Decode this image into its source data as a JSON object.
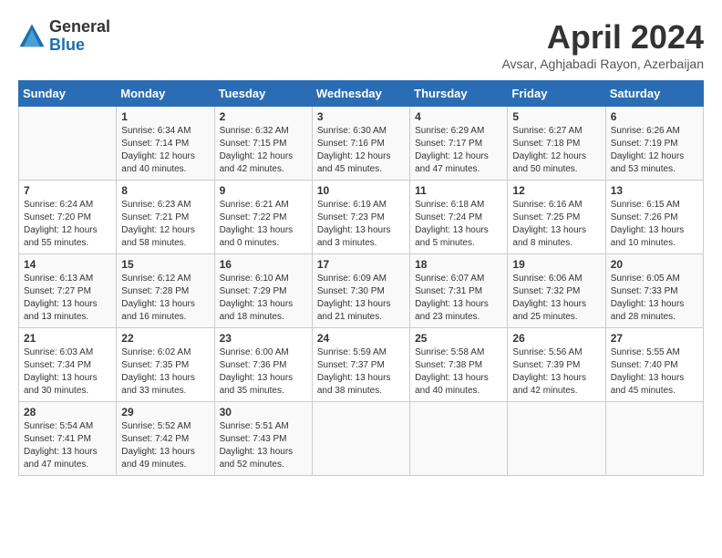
{
  "header": {
    "logo_general": "General",
    "logo_blue": "Blue",
    "title": "April 2024",
    "location": "Avsar, Aghjabadi Rayon, Azerbaijan"
  },
  "calendar": {
    "days_of_week": [
      "Sunday",
      "Monday",
      "Tuesday",
      "Wednesday",
      "Thursday",
      "Friday",
      "Saturday"
    ],
    "weeks": [
      [
        {
          "day": "",
          "sunrise": "",
          "sunset": "",
          "daylight": ""
        },
        {
          "day": "1",
          "sunrise": "Sunrise: 6:34 AM",
          "sunset": "Sunset: 7:14 PM",
          "daylight": "Daylight: 12 hours and 40 minutes."
        },
        {
          "day": "2",
          "sunrise": "Sunrise: 6:32 AM",
          "sunset": "Sunset: 7:15 PM",
          "daylight": "Daylight: 12 hours and 42 minutes."
        },
        {
          "day": "3",
          "sunrise": "Sunrise: 6:30 AM",
          "sunset": "Sunset: 7:16 PM",
          "daylight": "Daylight: 12 hours and 45 minutes."
        },
        {
          "day": "4",
          "sunrise": "Sunrise: 6:29 AM",
          "sunset": "Sunset: 7:17 PM",
          "daylight": "Daylight: 12 hours and 47 minutes."
        },
        {
          "day": "5",
          "sunrise": "Sunrise: 6:27 AM",
          "sunset": "Sunset: 7:18 PM",
          "daylight": "Daylight: 12 hours and 50 minutes."
        },
        {
          "day": "6",
          "sunrise": "Sunrise: 6:26 AM",
          "sunset": "Sunset: 7:19 PM",
          "daylight": "Daylight: 12 hours and 53 minutes."
        }
      ],
      [
        {
          "day": "7",
          "sunrise": "Sunrise: 6:24 AM",
          "sunset": "Sunset: 7:20 PM",
          "daylight": "Daylight: 12 hours and 55 minutes."
        },
        {
          "day": "8",
          "sunrise": "Sunrise: 6:23 AM",
          "sunset": "Sunset: 7:21 PM",
          "daylight": "Daylight: 12 hours and 58 minutes."
        },
        {
          "day": "9",
          "sunrise": "Sunrise: 6:21 AM",
          "sunset": "Sunset: 7:22 PM",
          "daylight": "Daylight: 13 hours and 0 minutes."
        },
        {
          "day": "10",
          "sunrise": "Sunrise: 6:19 AM",
          "sunset": "Sunset: 7:23 PM",
          "daylight": "Daylight: 13 hours and 3 minutes."
        },
        {
          "day": "11",
          "sunrise": "Sunrise: 6:18 AM",
          "sunset": "Sunset: 7:24 PM",
          "daylight": "Daylight: 13 hours and 5 minutes."
        },
        {
          "day": "12",
          "sunrise": "Sunrise: 6:16 AM",
          "sunset": "Sunset: 7:25 PM",
          "daylight": "Daylight: 13 hours and 8 minutes."
        },
        {
          "day": "13",
          "sunrise": "Sunrise: 6:15 AM",
          "sunset": "Sunset: 7:26 PM",
          "daylight": "Daylight: 13 hours and 10 minutes."
        }
      ],
      [
        {
          "day": "14",
          "sunrise": "Sunrise: 6:13 AM",
          "sunset": "Sunset: 7:27 PM",
          "daylight": "Daylight: 13 hours and 13 minutes."
        },
        {
          "day": "15",
          "sunrise": "Sunrise: 6:12 AM",
          "sunset": "Sunset: 7:28 PM",
          "daylight": "Daylight: 13 hours and 16 minutes."
        },
        {
          "day": "16",
          "sunrise": "Sunrise: 6:10 AM",
          "sunset": "Sunset: 7:29 PM",
          "daylight": "Daylight: 13 hours and 18 minutes."
        },
        {
          "day": "17",
          "sunrise": "Sunrise: 6:09 AM",
          "sunset": "Sunset: 7:30 PM",
          "daylight": "Daylight: 13 hours and 21 minutes."
        },
        {
          "day": "18",
          "sunrise": "Sunrise: 6:07 AM",
          "sunset": "Sunset: 7:31 PM",
          "daylight": "Daylight: 13 hours and 23 minutes."
        },
        {
          "day": "19",
          "sunrise": "Sunrise: 6:06 AM",
          "sunset": "Sunset: 7:32 PM",
          "daylight": "Daylight: 13 hours and 25 minutes."
        },
        {
          "day": "20",
          "sunrise": "Sunrise: 6:05 AM",
          "sunset": "Sunset: 7:33 PM",
          "daylight": "Daylight: 13 hours and 28 minutes."
        }
      ],
      [
        {
          "day": "21",
          "sunrise": "Sunrise: 6:03 AM",
          "sunset": "Sunset: 7:34 PM",
          "daylight": "Daylight: 13 hours and 30 minutes."
        },
        {
          "day": "22",
          "sunrise": "Sunrise: 6:02 AM",
          "sunset": "Sunset: 7:35 PM",
          "daylight": "Daylight: 13 hours and 33 minutes."
        },
        {
          "day": "23",
          "sunrise": "Sunrise: 6:00 AM",
          "sunset": "Sunset: 7:36 PM",
          "daylight": "Daylight: 13 hours and 35 minutes."
        },
        {
          "day": "24",
          "sunrise": "Sunrise: 5:59 AM",
          "sunset": "Sunset: 7:37 PM",
          "daylight": "Daylight: 13 hours and 38 minutes."
        },
        {
          "day": "25",
          "sunrise": "Sunrise: 5:58 AM",
          "sunset": "Sunset: 7:38 PM",
          "daylight": "Daylight: 13 hours and 40 minutes."
        },
        {
          "day": "26",
          "sunrise": "Sunrise: 5:56 AM",
          "sunset": "Sunset: 7:39 PM",
          "daylight": "Daylight: 13 hours and 42 minutes."
        },
        {
          "day": "27",
          "sunrise": "Sunrise: 5:55 AM",
          "sunset": "Sunset: 7:40 PM",
          "daylight": "Daylight: 13 hours and 45 minutes."
        }
      ],
      [
        {
          "day": "28",
          "sunrise": "Sunrise: 5:54 AM",
          "sunset": "Sunset: 7:41 PM",
          "daylight": "Daylight: 13 hours and 47 minutes."
        },
        {
          "day": "29",
          "sunrise": "Sunrise: 5:52 AM",
          "sunset": "Sunset: 7:42 PM",
          "daylight": "Daylight: 13 hours and 49 minutes."
        },
        {
          "day": "30",
          "sunrise": "Sunrise: 5:51 AM",
          "sunset": "Sunset: 7:43 PM",
          "daylight": "Daylight: 13 hours and 52 minutes."
        },
        {
          "day": "",
          "sunrise": "",
          "sunset": "",
          "daylight": ""
        },
        {
          "day": "",
          "sunrise": "",
          "sunset": "",
          "daylight": ""
        },
        {
          "day": "",
          "sunrise": "",
          "sunset": "",
          "daylight": ""
        },
        {
          "day": "",
          "sunrise": "",
          "sunset": "",
          "daylight": ""
        }
      ]
    ]
  }
}
